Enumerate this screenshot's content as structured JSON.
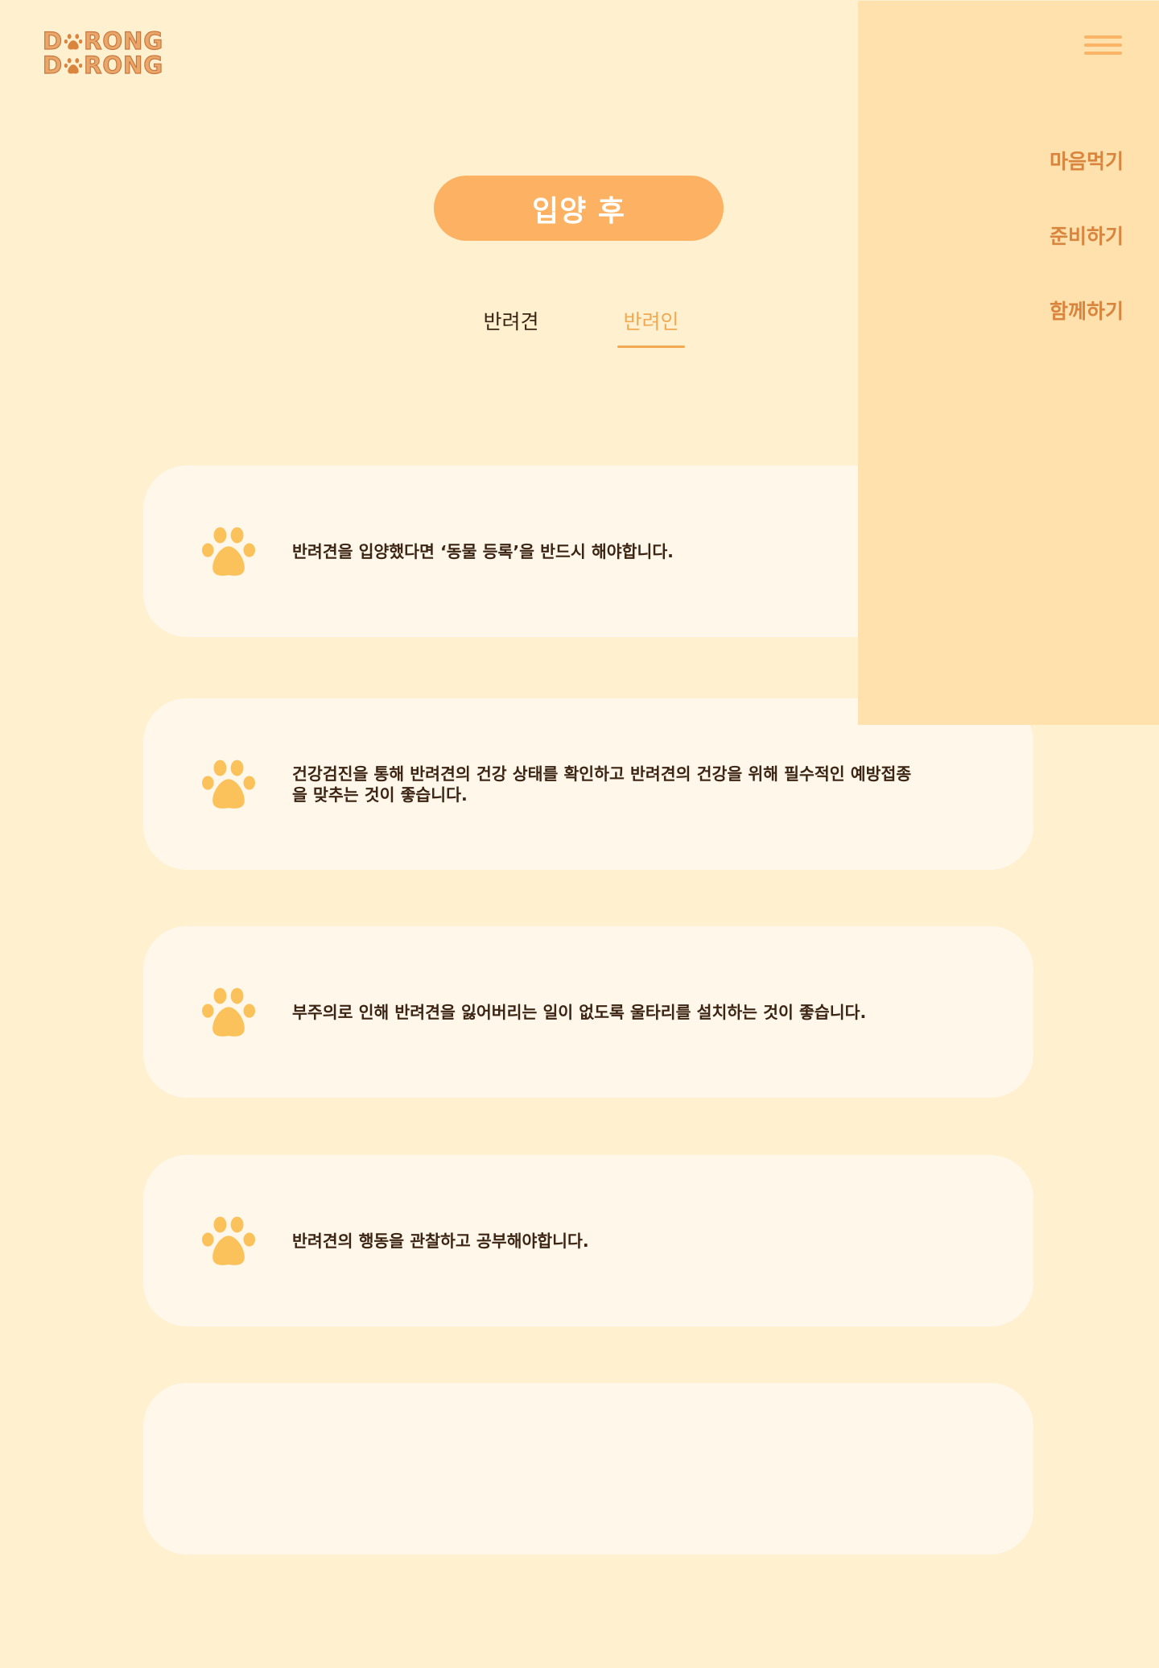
{
  "logo": {
    "line1_before": "D",
    "line1_after": "RONG",
    "line2_before": "D",
    "line2_after": "RONG"
  },
  "hero": {
    "title": "입양 후"
  },
  "tabs": [
    {
      "label": "반려견",
      "active": false
    },
    {
      "label": "반려인",
      "active": true
    }
  ],
  "cards": [
    {
      "text": "반려견을 입양했다면 ‘동물 등록’을 반드시 해야합니다.",
      "icon": "paw-icon"
    },
    {
      "text": "건강검진을 통해 반려견의 건강 상태를 확인하고 반려견의 건강을 위해 필수적인 예방접종을 맞추는 것이 좋습니다.",
      "icon": "paw-icon"
    },
    {
      "text": "부주의로 인해 반려견을 잃어버리는 일이 없도록 울타리를 설치하는 것이 좋습니다.",
      "icon": "paw-icon"
    },
    {
      "text": "반려견의 행동을 관찰하고 공부해야합니다.",
      "icon": "paw-icon"
    },
    {
      "text": "",
      "icon": ""
    }
  ],
  "menu": {
    "items": [
      {
        "label": "마음먹기"
      },
      {
        "label": "준비하기"
      },
      {
        "label": "함께하기"
      }
    ]
  },
  "colors": {
    "background": "#fff0cf",
    "card": "#fff7e9",
    "accent": "#fcb262",
    "paw": "#fbc15a",
    "menu_bg": "#ffe1ae",
    "menu_text": "#d9853e",
    "text": "#3b2414"
  }
}
